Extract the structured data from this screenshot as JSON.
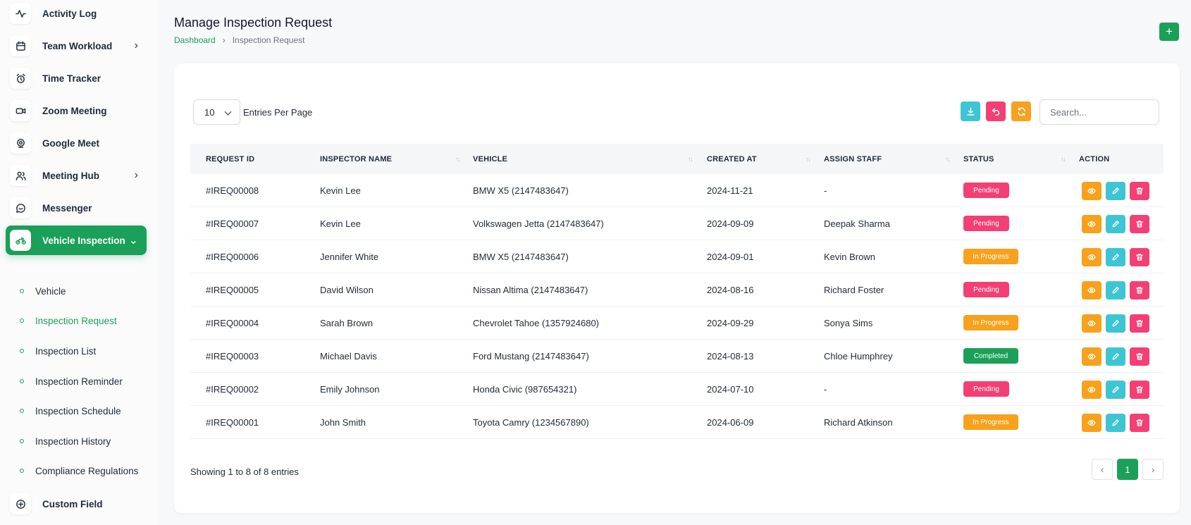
{
  "sidebar": {
    "items": [
      {
        "label": "Activity Log",
        "icon": "activity-icon"
      },
      {
        "label": "Team Workload",
        "icon": "calendar-icon",
        "chevron": "›"
      },
      {
        "label": "Time Tracker",
        "icon": "alarm-clock-icon"
      },
      {
        "label": "Zoom Meeting",
        "icon": "video-icon"
      },
      {
        "label": "Google Meet",
        "icon": "webcam-icon"
      },
      {
        "label": "Meeting Hub",
        "icon": "users-icon",
        "chevron": "›"
      },
      {
        "label": "Messenger",
        "icon": "chat-icon"
      },
      {
        "label": "Vehicle Inspection",
        "icon": "motorbike-icon",
        "chevron": "⌄"
      }
    ],
    "sub_items": [
      {
        "label": "Vehicle"
      },
      {
        "label": "Inspection Request"
      },
      {
        "label": "Inspection List"
      },
      {
        "label": "Inspection Reminder"
      },
      {
        "label": "Inspection Schedule"
      },
      {
        "label": "Inspection History"
      },
      {
        "label": "Compliance Regulations"
      }
    ],
    "footer_item": {
      "label": "Custom Field",
      "icon": "plus-circle-icon"
    }
  },
  "header": {
    "title": "Manage Inspection Request",
    "breadcrumb": {
      "link": "Dashboard",
      "separator": "›",
      "current": "Inspection Request"
    },
    "add_label": "+"
  },
  "controls": {
    "entries_value": "10",
    "entries_label": "Entries Per Page",
    "search_placeholder": "Search..."
  },
  "table": {
    "columns": [
      "REQUEST ID",
      "INSPECTOR NAME",
      "VEHICLE",
      "CREATED AT",
      "ASSIGN STAFF",
      "STATUS",
      "ACTION"
    ],
    "sort_glyph": "↑↓",
    "rows": [
      {
        "id": "#IREQ00008",
        "inspector": "Kevin Lee",
        "vehicle": "BMW X5 (2147483647)",
        "created": "2024-11-21",
        "staff": "-",
        "status": "Pending"
      },
      {
        "id": "#IREQ00007",
        "inspector": "Kevin Lee",
        "vehicle": "Volkswagen Jetta (2147483647)",
        "created": "2024-09-09",
        "staff": "Deepak Sharma",
        "status": "Pending"
      },
      {
        "id": "#IREQ00006",
        "inspector": "Jennifer White",
        "vehicle": "BMW X5 (2147483647)",
        "created": "2024-09-01",
        "staff": "Kevin Brown",
        "status": "In Progress"
      },
      {
        "id": "#IREQ00005",
        "inspector": "David Wilson",
        "vehicle": "Nissan Altima (2147483647)",
        "created": "2024-08-16",
        "staff": "Richard Foster",
        "status": "Pending"
      },
      {
        "id": "#IREQ00004",
        "inspector": "Sarah Brown",
        "vehicle": "Chevrolet Tahoe (1357924680)",
        "created": "2024-09-29",
        "staff": "Sonya Sims",
        "status": "In Progress"
      },
      {
        "id": "#IREQ00003",
        "inspector": "Michael Davis",
        "vehicle": "Ford Mustang (2147483647)",
        "created": "2024-08-13",
        "staff": "Chloe Humphrey",
        "status": "Completed"
      },
      {
        "id": "#IREQ00002",
        "inspector": "Emily Johnson",
        "vehicle": "Honda Civic (987654321)",
        "created": "2024-07-10",
        "staff": "-",
        "status": "Pending"
      },
      {
        "id": "#IREQ00001",
        "inspector": "John Smith",
        "vehicle": "Toyota Camry (1234567890)",
        "created": "2024-06-09",
        "staff": "Richard Atkinson",
        "status": "In Progress"
      }
    ]
  },
  "footer": {
    "showing": "Showing 1 to 8 of 8 entries",
    "prev": "‹",
    "page": "1",
    "next": "›"
  },
  "colors": {
    "accent": "#1aa058",
    "pending": "#f43f74",
    "in_progress": "#f7a11c",
    "completed": "#1aa058",
    "view": "#f7a11c",
    "edit": "#3ec5d3",
    "delete": "#f43f74",
    "export": "#3ec5d3",
    "reset": "#f43f74",
    "refresh": "#f7a11c"
  }
}
